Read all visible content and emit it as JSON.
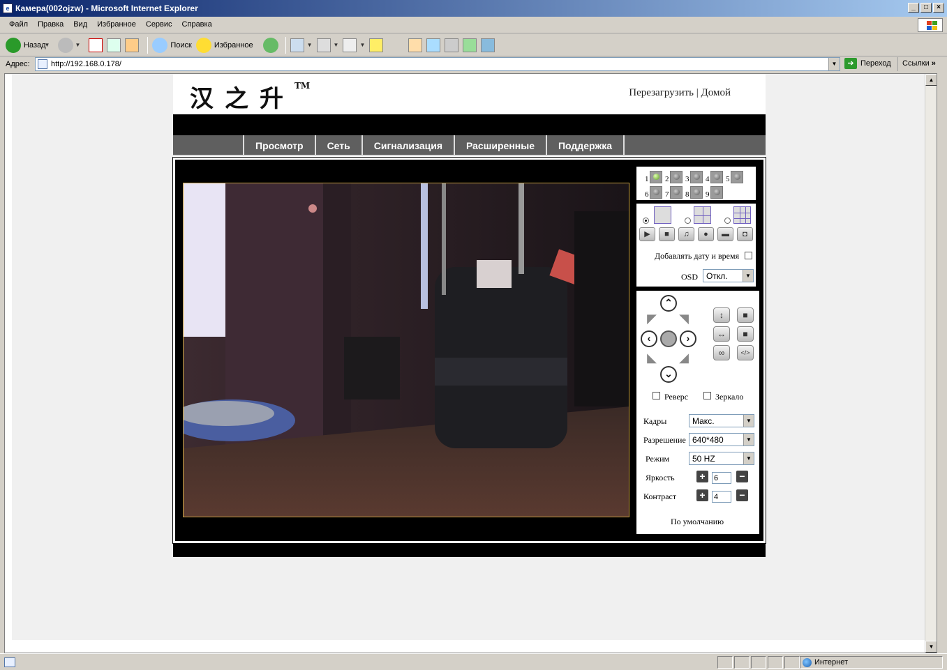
{
  "window": {
    "title": "Камера(002ojzw) - Microsoft Internet Explorer",
    "min": "_",
    "max": "□",
    "close": "×"
  },
  "menu": [
    "Файл",
    "Правка",
    "Вид",
    "Избранное",
    "Сервис",
    "Справка"
  ],
  "toolbar": {
    "back": "Назад",
    "search": "Поиск",
    "favorites": "Избранное"
  },
  "address": {
    "label": "Адрес:",
    "url": "http://192.168.0.178/",
    "go": "Переход",
    "links": "Ссылки"
  },
  "page": {
    "logo": "汉之升",
    "tm": "TM",
    "top_links": {
      "reboot": "Перезагрузить",
      "sep": "|",
      "home": "Домой"
    },
    "nav": [
      "Просмотр",
      "Сеть",
      "Сигнализация",
      "Расширенные",
      "Поддержка"
    ],
    "channels": [
      "1",
      "2",
      "3",
      "4",
      "5",
      "6",
      "7",
      "8",
      "9"
    ],
    "active_channel": "1",
    "add_datetime": "Добавлять дату и время",
    "osd_label": "OSD",
    "osd_value": "Откл.",
    "reverse": "Реверс",
    "mirror": "Зеркало",
    "frames_label": "Кадры",
    "frames_value": "Макс.",
    "resolution_label": "Разрешение",
    "resolution_value": "640*480",
    "mode_label": "Режим",
    "mode_value": "50 HZ",
    "brightness_label": "Яркость",
    "brightness_value": "6",
    "contrast_label": "Контраст",
    "contrast_value": "4",
    "default": "По умолчанию"
  },
  "status": {
    "zone": "Интернет"
  },
  "colors": {
    "titlebar": "#0a246a",
    "nav": "#5f5f5f",
    "page_bg": "#f0f0f0"
  }
}
